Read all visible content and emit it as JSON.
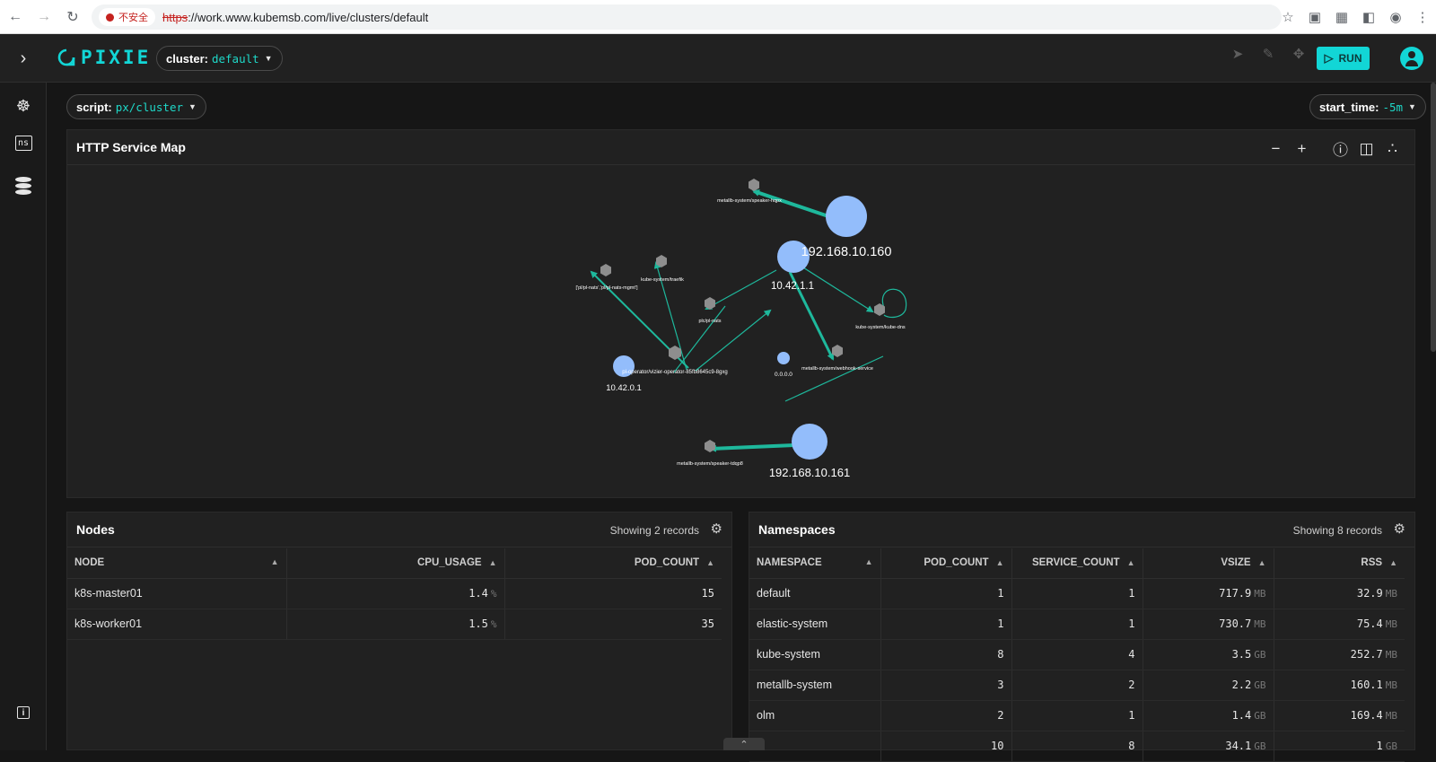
{
  "browser": {
    "security_label": "不安全",
    "url_protocol": "https",
    "url_rest": "://work.www.kubemsb.com/live/clusters/default"
  },
  "header": {
    "logo_text": "PIXIE",
    "cluster_label": "cluster:",
    "cluster_value": "default",
    "run_label": "RUN"
  },
  "toolbar": {
    "script_label": "script:",
    "script_value": "px/cluster",
    "start_time_label": "start_time:",
    "start_time_value": "-5m"
  },
  "service_map": {
    "title": "HTTP Service Map",
    "labels": {
      "ip160": "192.168.10.160",
      "ip161": "192.168.10.161",
      "ip_42_1_1": "10.42.1.1",
      "ip_42_0_1": "10.42.0.1",
      "zero": "0.0.0.0",
      "speaker_top": "metallb-system/speaker-hqpx",
      "speaker_bottom": "metallb-system/speaker-tdqp8",
      "traefik": "kube-system/traefik",
      "natsmgmt": "['pl/pl-nats','pl/pl-nats-mgmt']",
      "plnats": "plc/pl-nats",
      "vizier": "pl-operator/vizier-operator-85fb8645c9-8gxg",
      "kubedns": "kube-system/kube-dns",
      "webhook": "metallb-system/webhook-service"
    },
    "colors": {
      "node": "#93bdfb",
      "edge": "#1eb89c",
      "service": "#8e8e8e"
    }
  },
  "nodes_table": {
    "title": "Nodes",
    "record_count": "Showing 2 records",
    "columns": [
      "NODE",
      "CPU_USAGE",
      "POD_COUNT"
    ],
    "rows": [
      {
        "node": "k8s-master01",
        "cpu": "1.4",
        "cpu_unit": "%",
        "pods": "15"
      },
      {
        "node": "k8s-worker01",
        "cpu": "1.5",
        "cpu_unit": "%",
        "pods": "35"
      }
    ]
  },
  "namespaces_table": {
    "title": "Namespaces",
    "record_count": "Showing 8 records",
    "columns": [
      "NAMESPACE",
      "POD_COUNT",
      "SERVICE_COUNT",
      "VSIZE",
      "RSS"
    ],
    "rows": [
      {
        "ns": "default",
        "pods": "1",
        "svcs": "1",
        "vsize": "717.9",
        "vsize_unit": "MB",
        "rss": "32.9",
        "rss_unit": "MB"
      },
      {
        "ns": "elastic-system",
        "pods": "1",
        "svcs": "1",
        "vsize": "730.7",
        "vsize_unit": "MB",
        "rss": "75.4",
        "rss_unit": "MB"
      },
      {
        "ns": "kube-system",
        "pods": "8",
        "svcs": "4",
        "vsize": "3.5",
        "vsize_unit": "GB",
        "rss": "252.7",
        "rss_unit": "MB"
      },
      {
        "ns": "metallb-system",
        "pods": "3",
        "svcs": "2",
        "vsize": "2.2",
        "vsize_unit": "GB",
        "rss": "160.1",
        "rss_unit": "MB"
      },
      {
        "ns": "olm",
        "pods": "2",
        "svcs": "1",
        "vsize": "1.4",
        "vsize_unit": "GB",
        "rss": "169.4",
        "rss_unit": "MB"
      },
      {
        "ns": "",
        "pods": "10",
        "svcs": "8",
        "vsize": "34.1",
        "vsize_unit": "GB",
        "rss": "1",
        "rss_unit": "GB"
      }
    ]
  }
}
